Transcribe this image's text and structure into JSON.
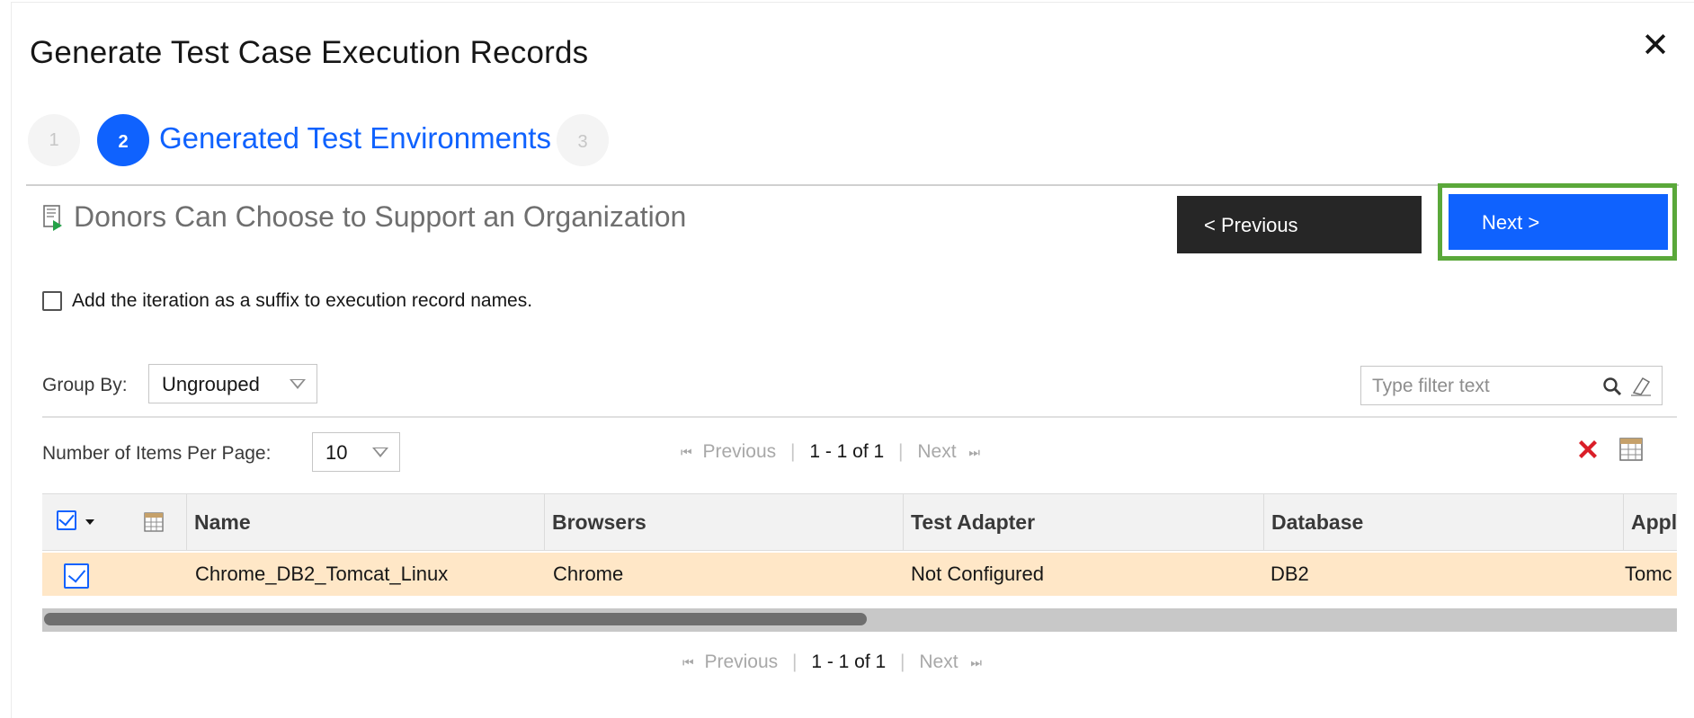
{
  "dialog": {
    "title": "Generate Test Case Execution Records",
    "close_symbol": "✕"
  },
  "steps": [
    {
      "number": "1"
    },
    {
      "number": "2",
      "label": "Generated Test Environments"
    },
    {
      "number": "3"
    }
  ],
  "plan": {
    "title": "Donors Can Choose to Support an Organization"
  },
  "buttons": {
    "previous": "< Previous",
    "next": "Next >"
  },
  "options": {
    "suffix_label": "Add the iteration as a suffix to execution record names."
  },
  "groupby": {
    "label": "Group By:",
    "value": "Ungrouped"
  },
  "filter": {
    "placeholder": "Type filter text"
  },
  "paging": {
    "per_page_label": "Number of Items Per Page:",
    "per_page_value": "10",
    "prev": "Previous",
    "range": "1 - 1 of 1",
    "next": "Next",
    "sep": "|"
  },
  "table": {
    "columns": [
      "Name",
      "Browsers",
      "Test Adapter",
      "Database",
      "Appli"
    ],
    "rows": [
      {
        "name": "Chrome_DB2_Tomcat_Linux",
        "browsers": "Chrome",
        "test_adapter": "Not Configured",
        "database": "DB2",
        "application": "Tomc"
      }
    ]
  },
  "colors": {
    "primary": "#0f62fe",
    "highlight_frame": "#5aa83a",
    "row_selected": "#ffe7c7",
    "delete_red": "#da1e28"
  },
  "icons": {
    "close": "close-icon",
    "plan": "test-plan-icon",
    "search": "search-icon",
    "clear": "eraser-icon",
    "delete": "delete-icon",
    "columns": "column-chooser-icon",
    "first_page": "first-page-icon",
    "last_page": "last-page-icon",
    "dropdown": "chevron-down-icon"
  }
}
